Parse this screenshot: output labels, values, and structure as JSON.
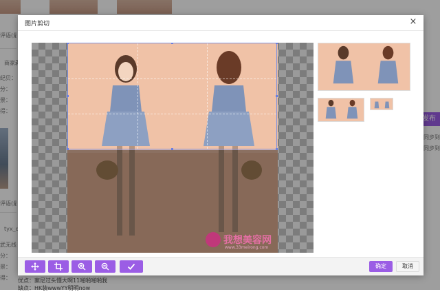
{
  "background": {
    "left_lines": [
      "评语(最",
      "商家剥",
      "纪贝：裹",
      "分：",
      "景：",
      "得：",
      "评语(最",
      "tyx_qu",
      "武无线",
      "分：",
      "景：",
      "得："
    ],
    "right_button": "发布",
    "right_lines": [
      "同步到",
      "同步到"
    ],
    "bottom_lines": [
      "优点：案尼过头懂大啊11啪啪啪啪我",
      "缺点：HK装wwwYY明明now"
    ]
  },
  "modal": {
    "title": "图片剪切",
    "close_label": "×",
    "watermark": {
      "text": "我想美容网",
      "sub": "www.33meirong.com"
    },
    "toolbar": {
      "move": {
        "icon": "move-icon"
      },
      "crop": {
        "icon": "crop-icon"
      },
      "zoom_in": {
        "icon": "zoom-in-icon"
      },
      "zoom_out": {
        "icon": "zoom-out-icon"
      },
      "apply": {
        "icon": "check-icon"
      }
    },
    "confirm_label": "确定",
    "cancel_label": "取消"
  },
  "colors": {
    "accent": "#9b5de5",
    "crop_border": "#7b8fe0",
    "photo_bg": "#f0c2a7"
  }
}
